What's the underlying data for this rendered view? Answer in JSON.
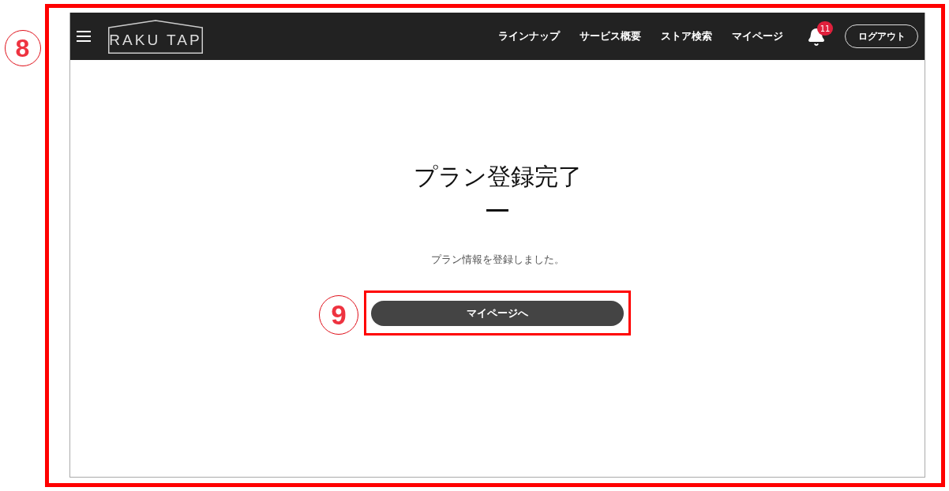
{
  "annotations": [
    {
      "label": "8"
    },
    {
      "label": "9"
    }
  ],
  "header": {
    "logo": "RAKU TAP",
    "nav": [
      "ラインナップ",
      "サービス概要",
      "ストア検索",
      "マイページ"
    ],
    "notification_count": "11",
    "logout": "ログアウト"
  },
  "main": {
    "title": "プラン登録完了",
    "message": "プラン情報を登録しました。",
    "button": "マイページへ"
  }
}
